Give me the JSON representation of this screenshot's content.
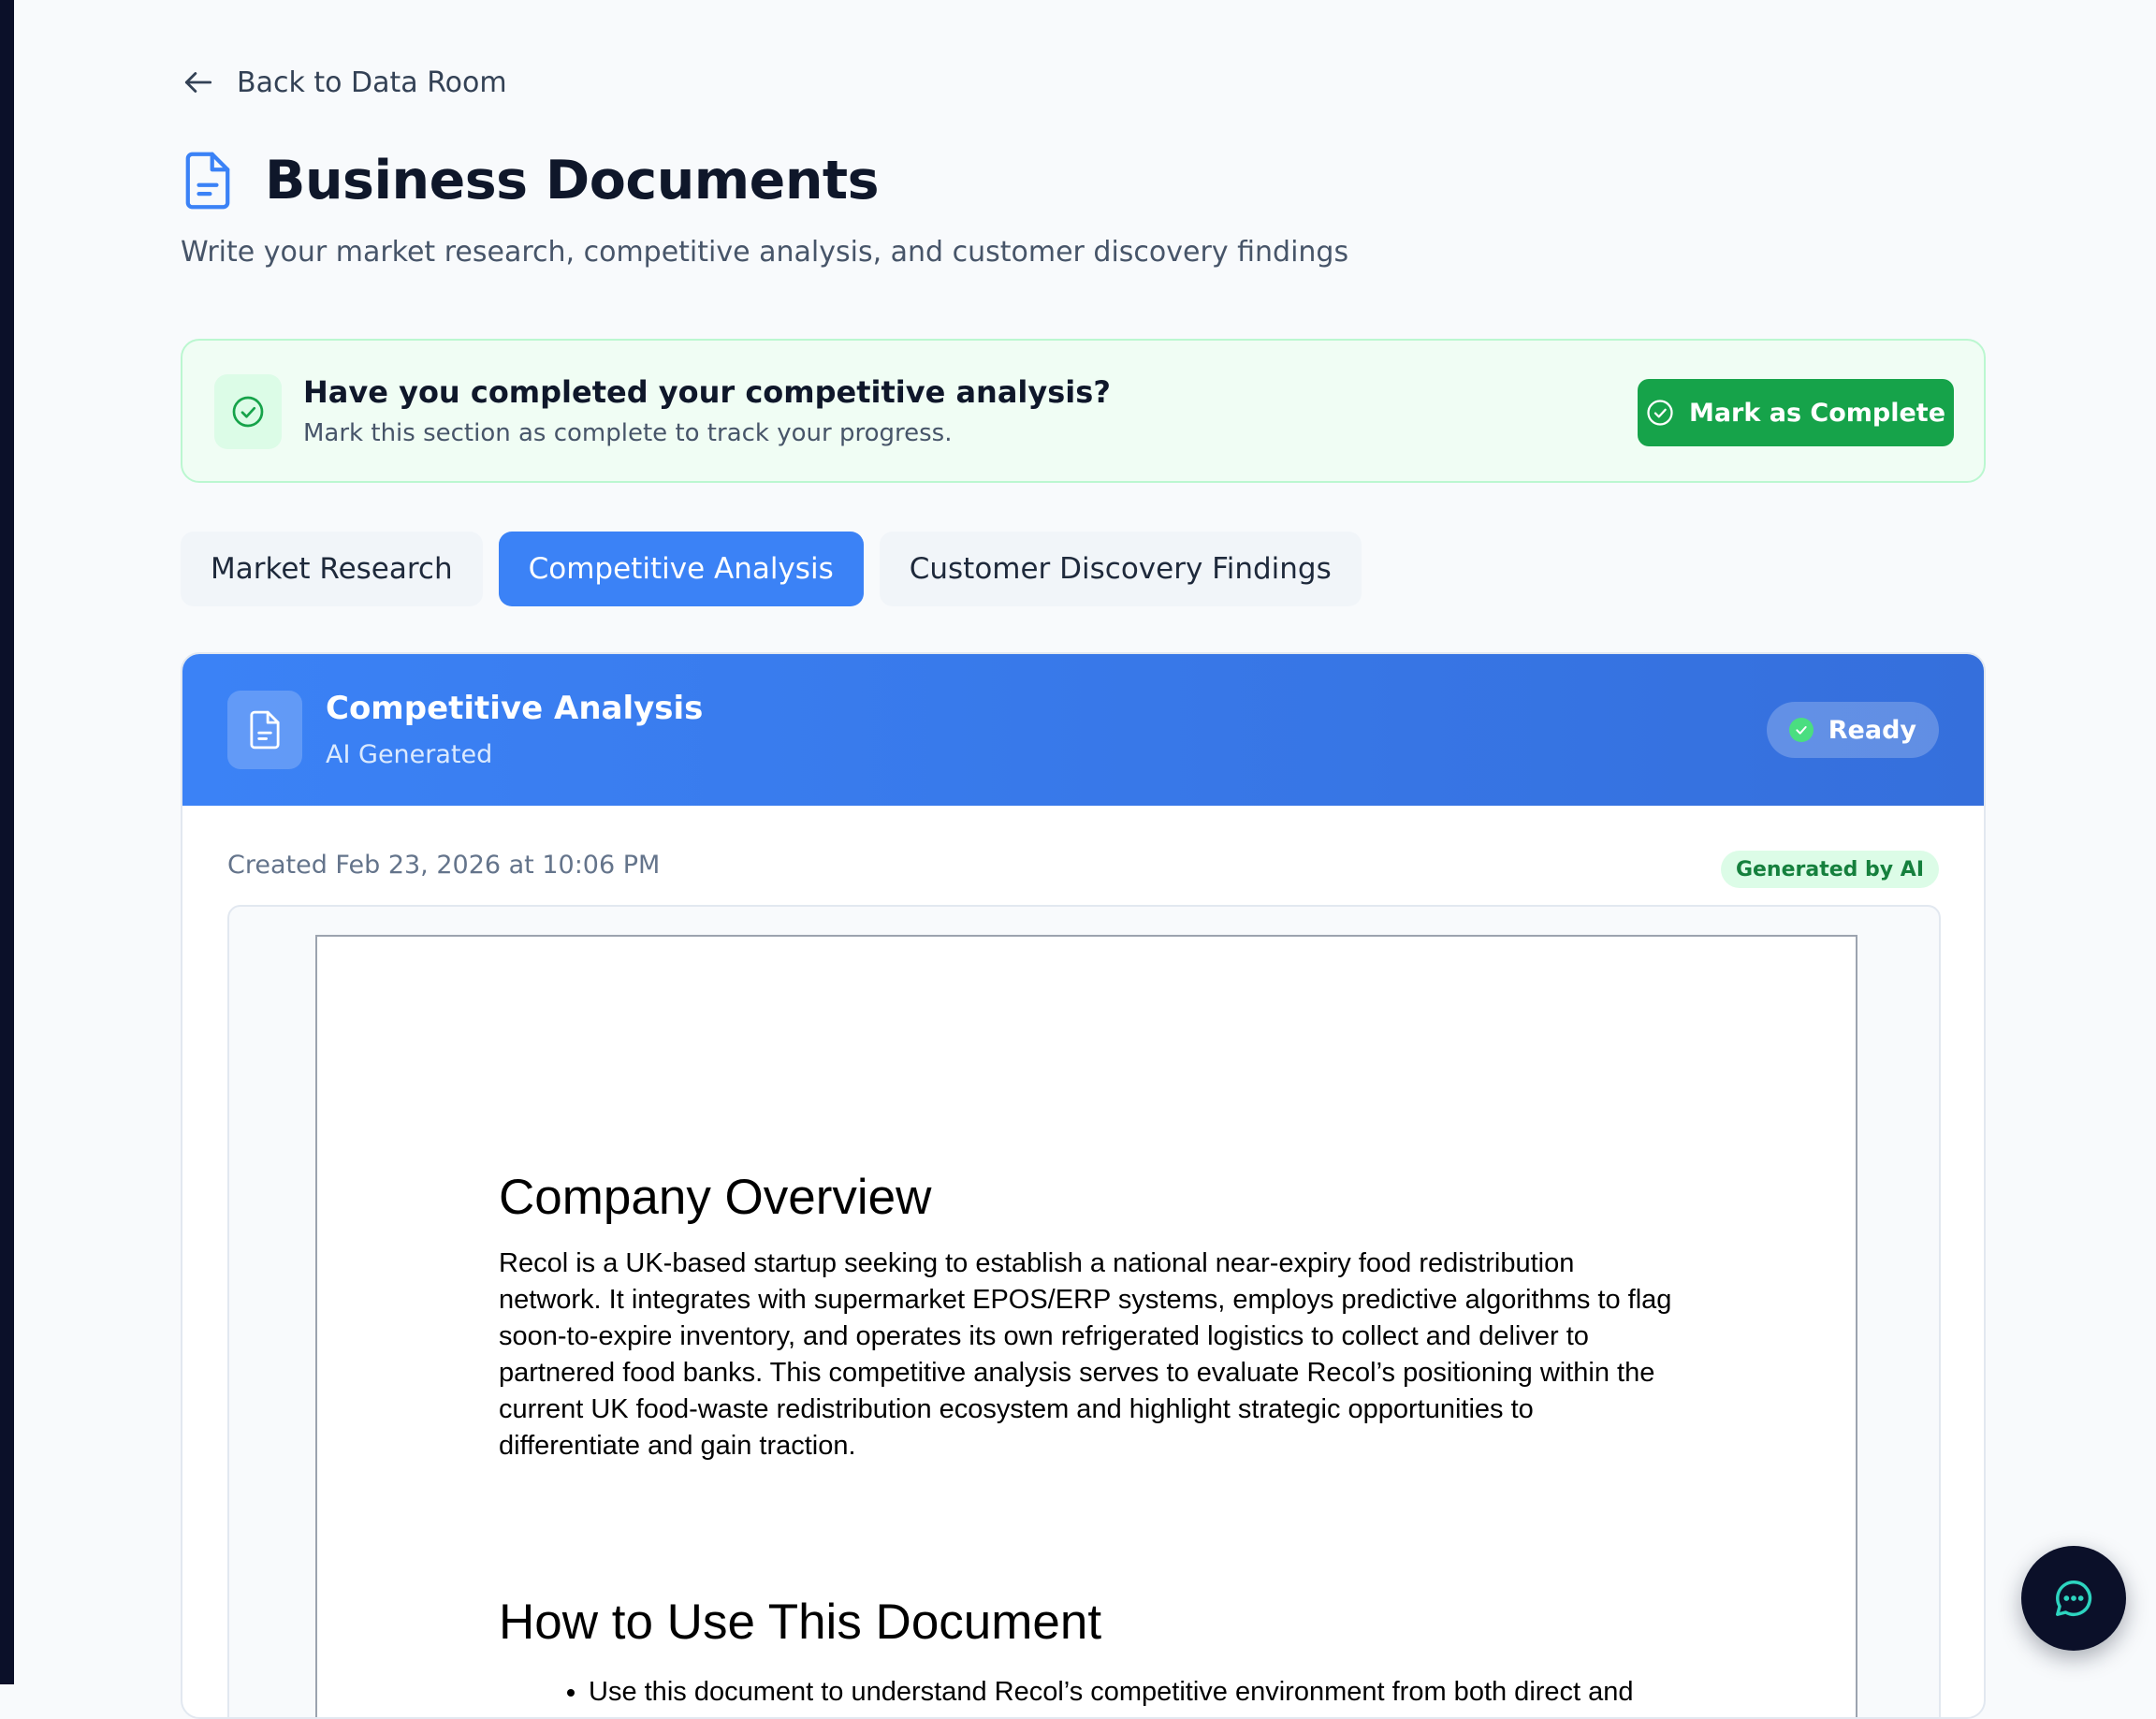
{
  "nav": {
    "back_label": "Back to Data Room"
  },
  "header": {
    "title": "Business Documents",
    "subtitle": "Write your market research, competitive analysis, and customer discovery findings"
  },
  "completion_banner": {
    "title": "Have you completed your competitive analysis?",
    "text": "Mark this section as complete to track your progress.",
    "button_label": "Mark as Complete"
  },
  "tabs": [
    {
      "label": "Market Research",
      "active": false
    },
    {
      "label": "Competitive Analysis",
      "active": true
    },
    {
      "label": "Customer Discovery Findings",
      "active": false
    }
  ],
  "document": {
    "title": "Competitive Analysis",
    "subtitle": "AI Generated",
    "status": "Ready",
    "created": "Created Feb 23, 2026 at 10:06 PM",
    "ai_badge": "Generated by AI",
    "content": {
      "heading_overview": "Company Overview",
      "overview_paragraph": "Recol is a UK-based startup seeking to establish a national near-expiry food redistribution network. It integrates with supermarket EPOS/ERP systems, employs predictive algorithms to flag soon-to-expire inventory, and operates its own refrigerated logistics to collect and deliver to partnered food banks. This competitive analysis serves to evaluate Recol’s positioning within the current UK food-waste redistribution ecosystem and highlight strategic opportunities to differentiate and gain traction.",
      "heading_usage": "How to Use This Document",
      "usage_items": [
        "Use this document to understand Recol’s competitive environment from both direct and"
      ]
    }
  },
  "colors": {
    "accent": "#3b82f6",
    "success": "#16a34a",
    "banner_bg": "#f0fdf4",
    "chat_bg": "#0b1029",
    "chat_icon": "#2dd4bf"
  },
  "icons": {
    "back": "arrow-left-icon",
    "title": "document-icon",
    "banner": "check-circle-icon",
    "button": "check-circle-icon",
    "doc_header": "document-icon",
    "status": "check-icon",
    "chat": "chat-bubble-icon"
  }
}
